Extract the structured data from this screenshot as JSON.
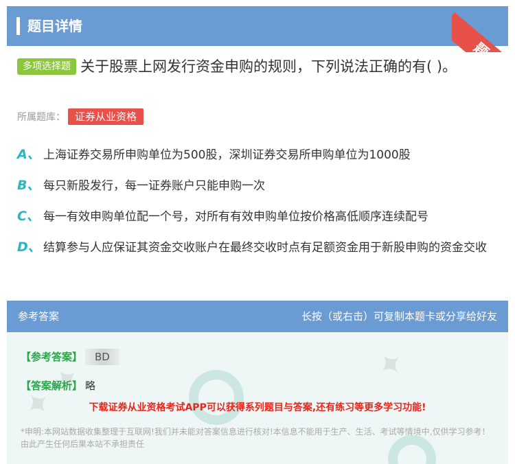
{
  "header": {
    "title": "题目详情",
    "ribbon": "题卡"
  },
  "question": {
    "type_tag": "多项选择题",
    "text": "关于股票上网发行资金申购的规则，下列说法正确的有(      )。",
    "bank_label": "所属题库：",
    "bank_name": "证券从业资格"
  },
  "options": [
    {
      "letter": "A、",
      "text": "上海证券交易所申购单位为500股，深圳证券交易所申购单位为1000股"
    },
    {
      "letter": "B、",
      "text": "每只新股发行，每一证券账户只能申购一次"
    },
    {
      "letter": "C、",
      "text": "每一有效申购单位配一个号，对所有有效申购单位按价格高低顺序连续配号"
    },
    {
      "letter": "D、",
      "text": "结算参与人应保证其资金交收账户在最终交收时点有足额资金用于新股申购的资金交收"
    }
  ],
  "answer_section": {
    "title": "参考答案",
    "hint": "长按（或右击）可复制本题卡或分享给好友",
    "answer_label": "【参考答案】",
    "answer_value": "BD",
    "analysis_label": "【答案解析】",
    "analysis_value": "略",
    "promo": "下载证券从业资格考试APP可以获得系列题目与答案,还有练习等更多学习功能!",
    "disclaimer": "*申明:本网站数据收集整理于互联网!我们并未能对答案信息进行核对!本信息不能用于生产、生活、考试等情境中,仅供学习参考！由此产生任何后果本站不承担责任"
  },
  "colors": {
    "header_bg": "#6a9bd3",
    "accent_red": "#e8504a",
    "option_letter": "#2ab5c4",
    "answer_green": "#2aa64a"
  }
}
